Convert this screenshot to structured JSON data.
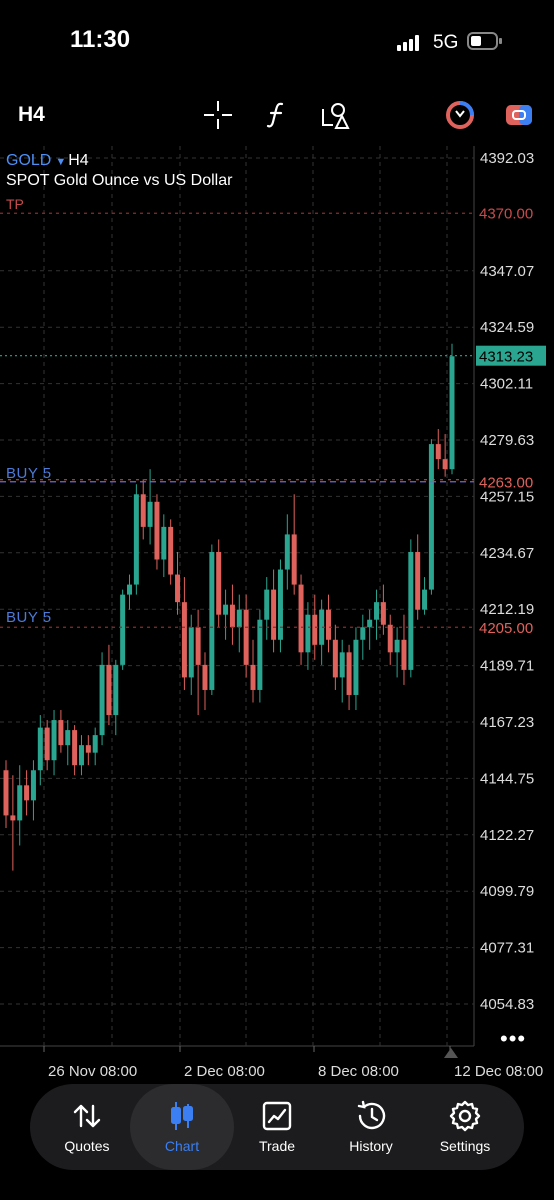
{
  "status": {
    "time": "11:30",
    "network": "5G"
  },
  "toolbar": {
    "timeframe": "H4",
    "icons": [
      "crosshair-icon",
      "indicator-function-icon",
      "objects-shapes-icon",
      "trade-toggle-icon",
      "one-click-trade-icon"
    ]
  },
  "symbol": {
    "name": "GOLD",
    "timeframe": "H4",
    "description": "SPOT Gold Ounce vs US Dollar",
    "tp_label": "TP"
  },
  "orders": [
    {
      "label": "BUY 5",
      "price": "4263.00"
    },
    {
      "label": "BUY 5",
      "price": "4205.00"
    }
  ],
  "tp_price": "4370.00",
  "current_price": "4313.23",
  "price_axis": [
    "4392.03",
    "4347.07",
    "4324.59",
    "4302.11",
    "4279.63",
    "4257.15",
    "4234.67",
    "4212.19",
    "4189.71",
    "4167.23",
    "4144.75",
    "4122.27",
    "4099.79",
    "4077.31",
    "4054.83"
  ],
  "time_axis": [
    "26 Nov 08:00",
    "2 Dec 08:00",
    "8 Dec 08:00",
    "12 Dec 08:00"
  ],
  "more_label": "•••",
  "colors": {
    "bull": "#2aa58f",
    "bear": "#e0625c",
    "accent": "#3b7ff2",
    "tp": "#c84b4b",
    "price_tag": "#2aa58f",
    "order_line": "#6a6ad8"
  },
  "chart_data": {
    "type": "candlestick",
    "symbol": "GOLD",
    "timeframe": "H4",
    "ylim": [
      4050,
      4395
    ],
    "candles": [
      [
        4148,
        4152,
        4125,
        4130
      ],
      [
        4130,
        4146,
        4108,
        4128
      ],
      [
        4128,
        4150,
        4118,
        4142
      ],
      [
        4142,
        4148,
        4130,
        4136
      ],
      [
        4136,
        4152,
        4128,
        4148
      ],
      [
        4148,
        4170,
        4142,
        4165
      ],
      [
        4165,
        4168,
        4148,
        4152
      ],
      [
        4152,
        4172,
        4146,
        4168
      ],
      [
        4168,
        4172,
        4155,
        4158
      ],
      [
        4158,
        4168,
        4150,
        4164
      ],
      [
        4164,
        4166,
        4146,
        4150
      ],
      [
        4150,
        4162,
        4146,
        4158
      ],
      [
        4158,
        4162,
        4150,
        4155
      ],
      [
        4155,
        4165,
        4150,
        4162
      ],
      [
        4162,
        4195,
        4158,
        4190
      ],
      [
        4190,
        4198,
        4166,
        4170
      ],
      [
        4170,
        4192,
        4162,
        4190
      ],
      [
        4190,
        4220,
        4188,
        4218
      ],
      [
        4218,
        4226,
        4212,
        4222
      ],
      [
        4222,
        4262,
        4218,
        4258
      ],
      [
        4258,
        4264,
        4240,
        4245
      ],
      [
        4245,
        4268,
        4238,
        4255
      ],
      [
        4255,
        4258,
        4228,
        4232
      ],
      [
        4232,
        4250,
        4225,
        4245
      ],
      [
        4245,
        4248,
        4222,
        4226
      ],
      [
        4226,
        4235,
        4210,
        4215
      ],
      [
        4215,
        4225,
        4180,
        4185
      ],
      [
        4185,
        4210,
        4178,
        4205
      ],
      [
        4205,
        4212,
        4170,
        4190
      ],
      [
        4190,
        4195,
        4172,
        4180
      ],
      [
        4180,
        4238,
        4178,
        4235
      ],
      [
        4235,
        4240,
        4205,
        4210
      ],
      [
        4210,
        4220,
        4200,
        4214
      ],
      [
        4214,
        4222,
        4198,
        4205
      ],
      [
        4205,
        4218,
        4195,
        4212
      ],
      [
        4212,
        4218,
        4185,
        4190
      ],
      [
        4190,
        4200,
        4175,
        4180
      ],
      [
        4180,
        4212,
        4175,
        4208
      ],
      [
        4208,
        4225,
        4200,
        4220
      ],
      [
        4220,
        4228,
        4195,
        4200
      ],
      [
        4200,
        4232,
        4195,
        4228
      ],
      [
        4228,
        4250,
        4220,
        4242
      ],
      [
        4242,
        4258,
        4218,
        4222
      ],
      [
        4222,
        4226,
        4190,
        4195
      ],
      [
        4195,
        4215,
        4188,
        4210
      ],
      [
        4210,
        4218,
        4192,
        4198
      ],
      [
        4198,
        4216,
        4190,
        4212
      ],
      [
        4212,
        4218,
        4195,
        4200
      ],
      [
        4200,
        4206,
        4180,
        4185
      ],
      [
        4185,
        4200,
        4175,
        4195
      ],
      [
        4195,
        4198,
        4172,
        4178
      ],
      [
        4178,
        4205,
        4172,
        4200
      ],
      [
        4200,
        4210,
        4192,
        4205
      ],
      [
        4205,
        4212,
        4196,
        4208
      ],
      [
        4208,
        4220,
        4200,
        4215
      ],
      [
        4215,
        4222,
        4202,
        4206
      ],
      [
        4206,
        4210,
        4190,
        4195
      ],
      [
        4195,
        4205,
        4185,
        4200
      ],
      [
        4200,
        4210,
        4182,
        4188
      ],
      [
        4188,
        4240,
        4185,
        4235
      ],
      [
        4235,
        4242,
        4208,
        4212
      ],
      [
        4212,
        4225,
        4210,
        4220
      ],
      [
        4220,
        4280,
        4218,
        4278
      ],
      [
        4278,
        4284,
        4268,
        4272
      ],
      [
        4272,
        4282,
        4265,
        4268
      ],
      [
        4268,
        4318,
        4266,
        4313
      ]
    ],
    "x_tick_labels": [
      "26 Nov 08:00",
      "2 Dec 08:00",
      "8 Dec 08:00",
      "12 Dec 08:00"
    ],
    "y_tick_labels": [
      "4392.03",
      "4347.07",
      "4324.59",
      "4302.11",
      "4279.63",
      "4257.15",
      "4234.67",
      "4212.19",
      "4189.71",
      "4167.23",
      "4144.75",
      "4122.27",
      "4099.79",
      "4077.31",
      "4054.83"
    ],
    "levels": {
      "tp": 4370.0,
      "buy_1": 4263.0,
      "buy_2": 4205.0,
      "current": 4313.23
    },
    "grid": true
  },
  "tabs": [
    {
      "label": "Quotes",
      "icon": "arrows-updown-icon",
      "active": false
    },
    {
      "label": "Chart",
      "icon": "candles-icon",
      "active": true
    },
    {
      "label": "Trade",
      "icon": "line-chart-box-icon",
      "active": false
    },
    {
      "label": "History",
      "icon": "clock-history-icon",
      "active": false
    },
    {
      "label": "Settings",
      "icon": "gear-icon",
      "active": false
    }
  ]
}
